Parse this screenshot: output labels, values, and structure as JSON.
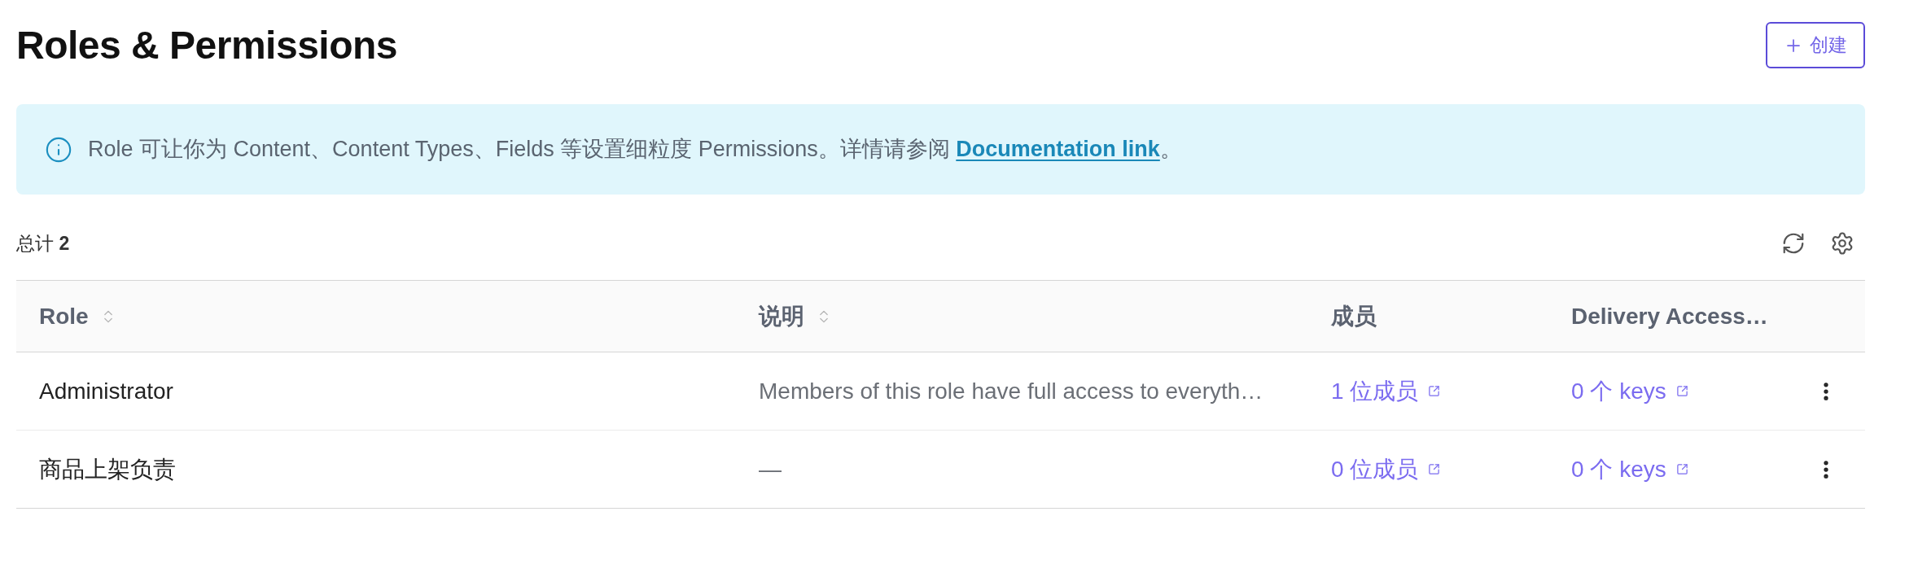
{
  "page": {
    "title": "Roles & Permissions",
    "create_button": {
      "label": "创建"
    }
  },
  "notice": {
    "text": "Role 可让你为 Content、Content Types、Fields 等设置细粒度 Permissions。详情请参阅",
    "link": "Documentation link",
    "suffix": "。"
  },
  "summary": {
    "text": "总计 **2**"
  },
  "table": {
    "columns": [
      {
        "label": "Role",
        "sortable": true
      },
      {
        "label": "说明",
        "sortable": true
      },
      {
        "label": "成员",
        "sortable": false
      },
      {
        "label": "Delivery Access…",
        "sortable": false
      }
    ],
    "rows": [
      {
        "role": "Administrator",
        "description": "Members of this role have full access to everyth…",
        "members": "1 位成员",
        "keys": "0 个 keys"
      },
      {
        "role": "商品上架负责",
        "description": "—",
        "members": "0 位成员",
        "keys": "0 个 keys"
      }
    ]
  }
}
